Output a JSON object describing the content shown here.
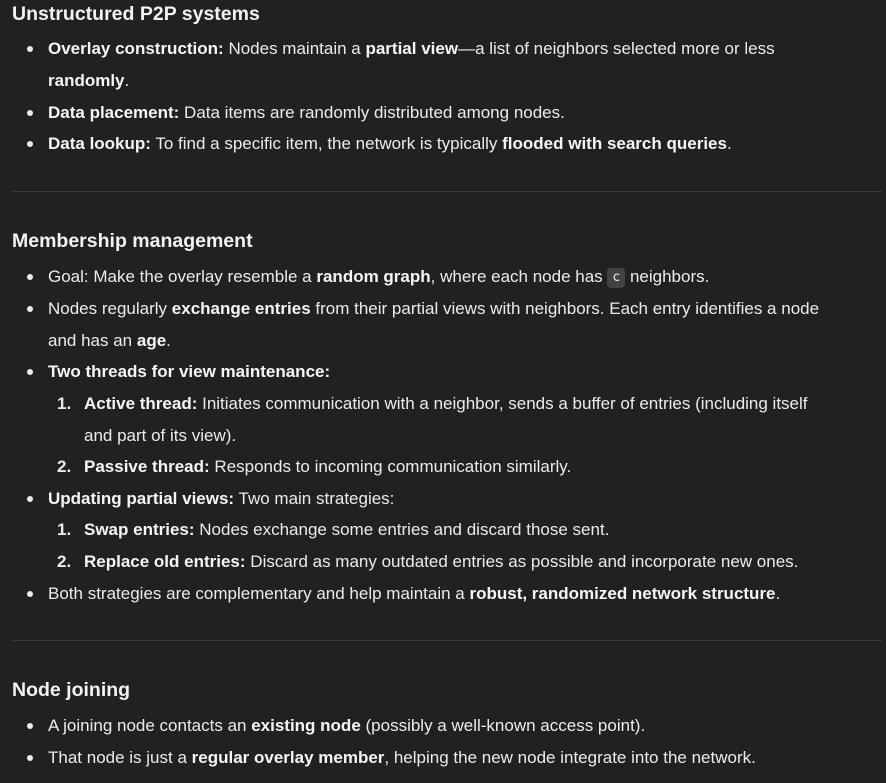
{
  "sections": [
    {
      "title": "Unstructured P2P systems",
      "items": [
        {
          "b1": "Overlay construction:",
          "t1": " Nodes maintain a ",
          "b2": "partial view",
          "t2": "—a list of neighbors selected more or less",
          "t3": "randomly",
          "t4": "."
        },
        {
          "b1": "Data placement:",
          "t1": " Data items are randomly distributed among nodes."
        },
        {
          "b1": "Data lookup:",
          "t1": " To find a specific item, the network is typically ",
          "b2": "flooded with search queries",
          "t2": "."
        }
      ]
    },
    {
      "title": "Membership management",
      "items": [
        {
          "t1": "Goal: Make the overlay resemble a ",
          "b1": "random graph",
          "t2": ", where each node has ",
          "code": "c",
          "t3": " neighbors."
        },
        {
          "t1": "Nodes regularly ",
          "b1": "exchange entries",
          "t2": " from their partial views with neighbors. Each entry identifies a node",
          "t3": "and has an ",
          "b2": "age",
          "t4": "."
        },
        {
          "b1": "Two threads for view maintenance:"
        },
        {
          "b1": "Updating partial views:",
          "t1": " Two main strategies:"
        },
        {
          "t1": "Both strategies are complementary and help maintain a ",
          "b1": "robust, randomized network structure",
          "t2": "."
        }
      ],
      "threads": [
        {
          "num": "1.",
          "b1": "Active thread:",
          "t1": " Initiates communication with a neighbor, sends a buffer of entries (including itself",
          "t2": "and part of its view)."
        },
        {
          "num": "2.",
          "b1": "Passive thread:",
          "t1": " Responds to incoming communication similarly."
        }
      ],
      "strategies": [
        {
          "num": "1.",
          "b1": "Swap entries:",
          "t1": " Nodes exchange some entries and discard those sent."
        },
        {
          "num": "2.",
          "b1": "Replace old entries:",
          "t1": " Discard as many outdated entries as possible and incorporate new ones."
        }
      ]
    },
    {
      "title": "Node joining",
      "items": [
        {
          "t1": "A joining node contacts an ",
          "b1": "existing node",
          "t2": " (possibly a well-known access point)."
        },
        {
          "t1": "That node is just a ",
          "b1": "regular overlay member",
          "t2": ", helping the new node integrate into the network."
        }
      ]
    }
  ],
  "colors": {
    "background": "#212121",
    "text": "#ececec",
    "divider": "#3a3a3a",
    "code_bg": "#424242"
  }
}
